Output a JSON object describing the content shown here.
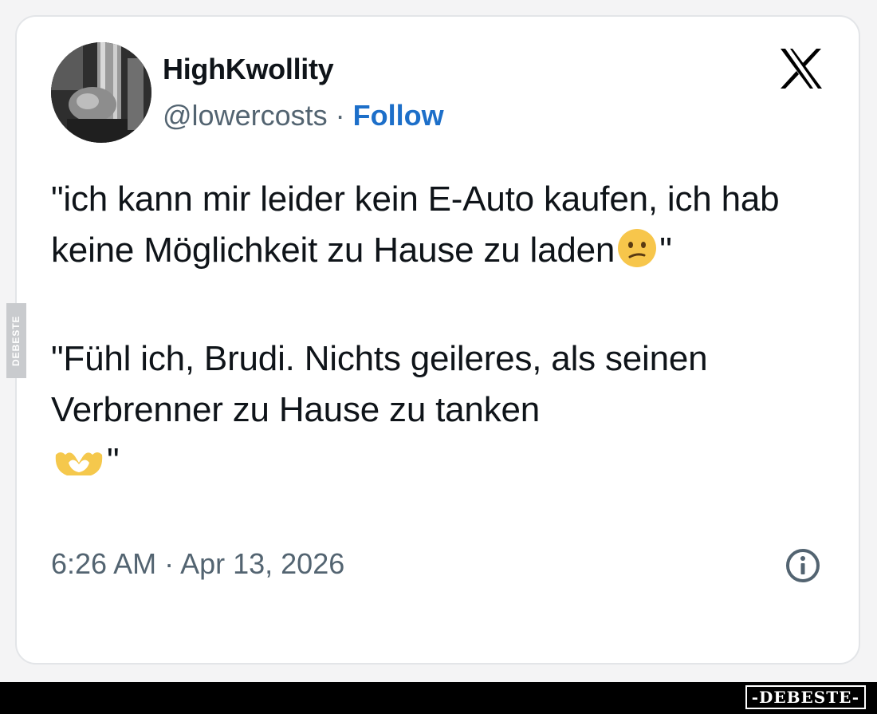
{
  "tweet": {
    "display_name": "HighKwollity",
    "handle": "@lowercosts",
    "separator": "·",
    "follow_label": "Follow",
    "text_para1": "\"ich kann mir leider kein E-Auto kaufen, ich hab keine Möglichkeit zu Hause zu laden",
    "text_para1_end": "\"",
    "text_para2": "\"Fühl ich, Brudi. Nichts geileres, als seinen Verbrenner zu Hause zu tanken",
    "text_para2_end": "\"",
    "timestamp": "6:26 AM · Apr 13, 2026",
    "icons": [
      "x-logo-icon",
      "info-icon",
      "confused-face-emoji",
      "heart-hands-emoji"
    ]
  },
  "watermark": {
    "side_text": "DEBESTE",
    "brand_text": "-DEBESTE-"
  },
  "colors": {
    "handle": "#536471",
    "follow": "#1d6fc9",
    "text": "#0f1419",
    "emoji_yellow": "#f7c64b"
  }
}
